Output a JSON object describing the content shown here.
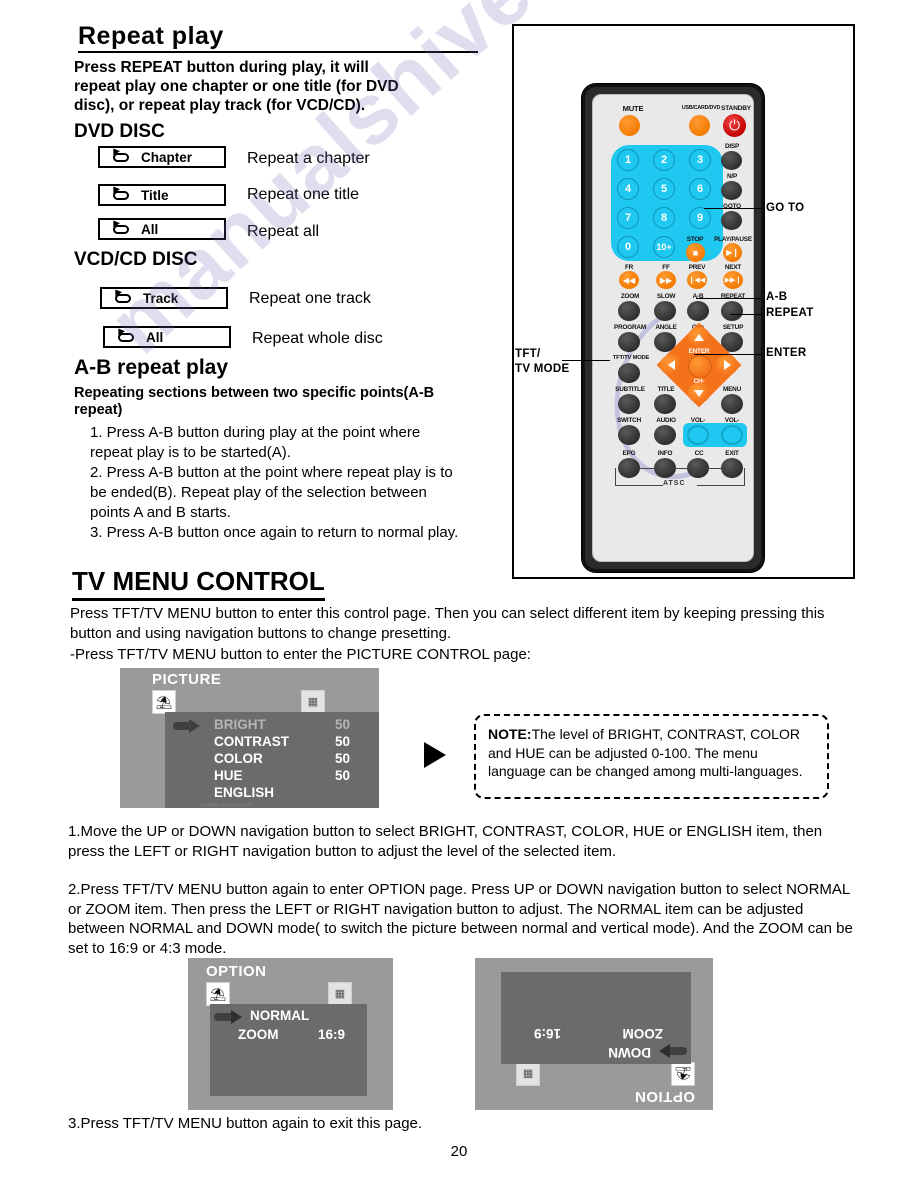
{
  "section1": {
    "heading": "Repeat play",
    "intro": "Press REPEAT button during play, it will repeat play one chapter or one title (for DVD disc), or repeat play track (for VCD/CD).",
    "dvd_heading": "DVD DISC",
    "vcd_heading": "VCD/CD DISC",
    "rows": [
      {
        "box": "Chapter",
        "desc": "Repeat a chapter"
      },
      {
        "box": "Title",
        "desc": "Repeat one title"
      },
      {
        "box": "All",
        "desc": "Repeat all"
      },
      {
        "box": "Track",
        "desc": "Repeat one track"
      },
      {
        "box": "All",
        "desc": "Repeat whole disc"
      }
    ]
  },
  "ab": {
    "heading": "A-B repeat play",
    "subheading": "Repeating sections between two specific points(A-B repeat)",
    "steps": [
      "1. Press A-B button during play at the point where repeat play is to be started(A).",
      "2. Press A-B button at the point where repeat play is to be ended(B). Repeat play of the selection between points A and B starts.",
      "3. Press A-B button once again to return to normal play."
    ]
  },
  "tvmenu": {
    "heading": "TV MENU CONTROL",
    "p1": "Press TFT/TV MENU button to enter this control page. Then you can select different item by keeping pressing this button and using navigation buttons to change presetting.",
    "p2": "-Press TFT/TV MENU button to enter the PICTURE CONTROL page:",
    "p3": "1.Move the UP or DOWN navigation button to select BRIGHT, CONTRAST, COLOR, HUE or ENGLISH item, then press the LEFT or RIGHT navigation button to adjust the level of the selected item.",
    "p4": "2.Press TFT/TV MENU button again to enter OPTION page. Press UP or DOWN navigation button to select NORMAL or ZOOM item. Then press the LEFT or RIGHT navigation button to adjust. The NORMAL item can be adjusted between NORMAL and DOWN mode( to switch the picture between normal and vertical mode). And the ZOOM can be set to 16:9 or 4:3 mode.",
    "p5": "3.Press TFT/TV MENU button again to exit this page."
  },
  "note": {
    "label": "NOTE:",
    "text": "The level of  BRIGHT, CONTRAST, COLOR and  HUE can be adjusted 0-100. The menu language can be changed among multi-languages."
  },
  "picture_osd": {
    "title": "PICTURE",
    "items": [
      {
        "label": "BRIGHT",
        "value": "50",
        "selected": true
      },
      {
        "label": "CONTRAST",
        "value": "50",
        "selected": false
      },
      {
        "label": "COLOR",
        "value": "50",
        "selected": false
      },
      {
        "label": "HUE",
        "value": "50",
        "selected": false
      },
      {
        "label": "ENGLISH",
        "value": "",
        "selected": false
      }
    ],
    "footer": "NORMAL  ENGLISH  16:9"
  },
  "option_osd": {
    "title": "OPTION",
    "items": [
      {
        "label": "NORMAL",
        "value": "",
        "selected": true
      },
      {
        "label": "ZOOM",
        "value": "16:9",
        "selected": false
      }
    ]
  },
  "option_osd_flipped": {
    "title": "OPTION",
    "items": [
      {
        "label": "DOWN",
        "value": "",
        "selected": true
      },
      {
        "label": "ZOOM",
        "value": "16:9",
        "selected": false
      }
    ]
  },
  "remote": {
    "top_labels": {
      "mute": "MUTE",
      "source": "USB/CARD/DVD",
      "standby": "STANDBY"
    },
    "numbers": [
      "1",
      "2",
      "3",
      "4",
      "5",
      "6",
      "7",
      "8",
      "9",
      "0",
      "10+"
    ],
    "right_column": [
      "DISP",
      "N/P",
      "GOTO"
    ],
    "transport": [
      "STOP",
      "PLAY/PAUSE",
      "FR",
      "FF",
      "PREV",
      "NEXT"
    ],
    "rows": [
      [
        "ZOOM",
        "SLOW",
        "A-B",
        "REPEAT"
      ],
      [
        "PROGRAM",
        "ANGLE",
        "CH+",
        "SETUP"
      ],
      [
        "TFT/TV MODE",
        "",
        "ENTER",
        ""
      ],
      [
        "SUBTITLE",
        "TITLE",
        "CH-",
        "MENU"
      ],
      [
        "SWITCH",
        "AUDIO",
        "VOL-",
        "VOL-"
      ],
      [
        "EPG",
        "INFO",
        "CC",
        "EXIT"
      ]
    ],
    "brand": "ATSC",
    "callouts": {
      "goto": "GO TO",
      "ab": "A-B",
      "repeat": "REPEAT",
      "enter": "ENTER",
      "tft_line1": "TFT/",
      "tft_line2": "TV MODE"
    }
  },
  "footer": {
    "page_number": "20"
  },
  "watermark": {
    "text": "manualshive.com"
  }
}
